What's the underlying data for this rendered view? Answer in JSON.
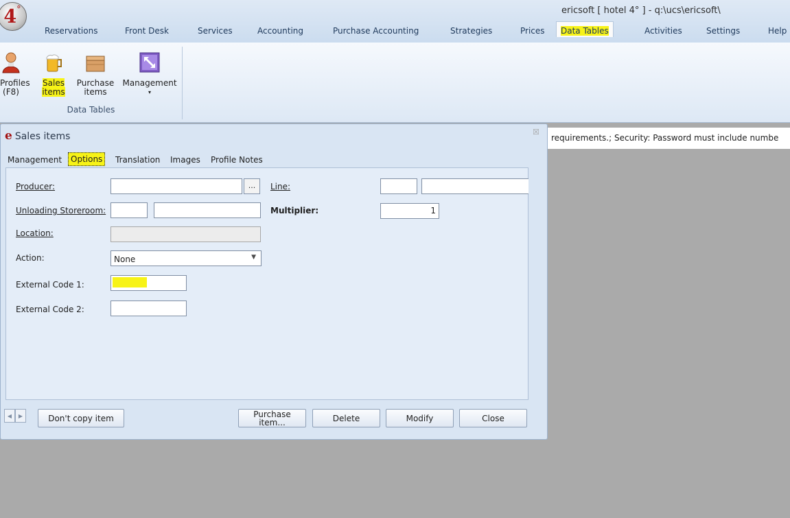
{
  "app": {
    "logo_text": "4",
    "logo_sup": "°",
    "window_title": "ericsoft [ hotel 4° ] - q:\\ucs\\ericsoft\\"
  },
  "menu": {
    "tabs": [
      "Reservations",
      "Front Desk",
      "Services",
      "Accounting",
      "Purchase Accounting",
      "Strategies",
      "Prices",
      "Data Tables",
      "Activities",
      "Settings",
      "Help"
    ],
    "active": "Data Tables"
  },
  "ribbon": {
    "buttons": [
      {
        "label_line1": "Profiles",
        "label_line2": "(F8)",
        "icon": "profile-person-icon"
      },
      {
        "label_line1": "Sales",
        "label_line2": "items",
        "icon": "beer-mug-icon"
      },
      {
        "label_line1": "Purchase",
        "label_line2": "items",
        "icon": "box-icon"
      },
      {
        "label_line1": "Management",
        "label_line2": "▾",
        "icon": "management-expand-icon"
      }
    ],
    "group_label": "Data Tables"
  },
  "status_strip": {
    "text": "requirements.; Security: Password must include numbe"
  },
  "dialog": {
    "title": "Sales items",
    "icon_letter": "e",
    "close_glyph": "☒",
    "tabs": [
      "Management",
      "Options",
      "Translation",
      "Images",
      "Profile Notes"
    ],
    "active_tab": "Options",
    "fields": {
      "producer": {
        "label": "Producer:",
        "value": "",
        "browse": "..."
      },
      "line": {
        "label": "Line:",
        "code": "",
        "name": ""
      },
      "unloading": {
        "label": "Unloading Storeroom:",
        "code": "",
        "name": ""
      },
      "multiplier": {
        "label": "Multiplier:",
        "value": "1"
      },
      "location": {
        "label": "Location:",
        "value": ""
      },
      "action": {
        "label": "Action:",
        "value": "None"
      },
      "ext1": {
        "label": "External Code 1:",
        "value": ""
      },
      "ext2": {
        "label": "External Code 2:",
        "value": ""
      }
    },
    "footer": {
      "nav_prev": "◀",
      "nav_next": "▶",
      "dont_copy": "Don't copy item",
      "purchase_line1": "Purchase",
      "purchase_line2": "item...",
      "delete": "Delete",
      "modify": "Modify",
      "close": "Close"
    }
  },
  "colors": {
    "highlight": "#f7f317",
    "background": "#aaaaaa",
    "dialog": "#d9e5f3",
    "logo_red": "#b01818"
  }
}
